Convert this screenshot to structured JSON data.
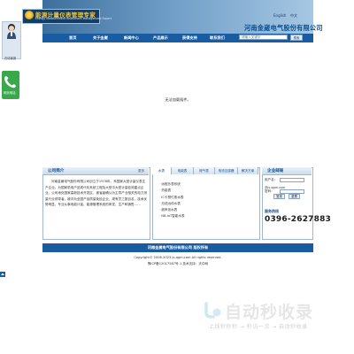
{
  "header": {
    "logo_cn": "能源计量仪表管理专家",
    "logo_en": "Energy Measurement Instrument Management Expert",
    "lang_en": "English",
    "lang_cn": "中文",
    "company_name": "河南金崴电气股份有限公司",
    "nav": [
      "首页",
      "关于金崴",
      "新闻中心",
      "产品展示",
      "获得支持",
      "联系我们"
    ],
    "search_placeholder": "请输入关键字",
    "search_button": "搜索"
  },
  "sidebar_widgets": {
    "cs_status": "在线客服",
    "phone_label": "网页电话"
  },
  "banner": {
    "message": "无法加载插件。"
  },
  "about": {
    "title": "公司简介",
    "more": "更多",
    "text": "河南金崴电气股份有限公司创立于1978年，系国家大型计量仪表生产企业，为国家机电产品现代化系统工程及大型中大型计量检测重点企业。公司地处国家高新技术开发区，被省级确认为主导产业相关的电力测量行业领导者，被评为全国产品质量免检企业，现有员工数百名，技术优势明显，专业从事电能计量、能源管理系统的研发、生产和销售……"
  },
  "tabs": {
    "labels": [
      "水表",
      "电能表",
      "燃气表",
      "电流互感器",
      "解决方案"
    ],
    "items": [
      "远程抄表系统",
      "热能表",
      "IC卡预付费水表",
      "无线远传水表",
      "超声波水表",
      "NB-IoT智能水表"
    ]
  },
  "contact": {
    "title": "企业邮局",
    "user_label": "用户名：",
    "pass_label": "密码：",
    "email_domain": "@js-qgm.com",
    "login_button": "登录",
    "reset_button": "重置",
    "hotline_label": "服务热线",
    "hotline": "0396-2627883"
  },
  "footer": {
    "links": "河南金崴电气股份有限公司 版权所有",
    "copyright": "Copyright© 2006-2023 js-qgm.com All rights reserved.",
    "icp": "豫ICP备12017587号-1 技术支持：天中网"
  },
  "watermark": {
    "text": "自动秒收录",
    "sub": "上线秒秒秒 → 秒访一次 → 自动秒收录"
  },
  "colors": {
    "nav_blue": "#1a5ca2",
    "title_blue": "#0c4f8f",
    "phone_green": "#39a84a"
  }
}
